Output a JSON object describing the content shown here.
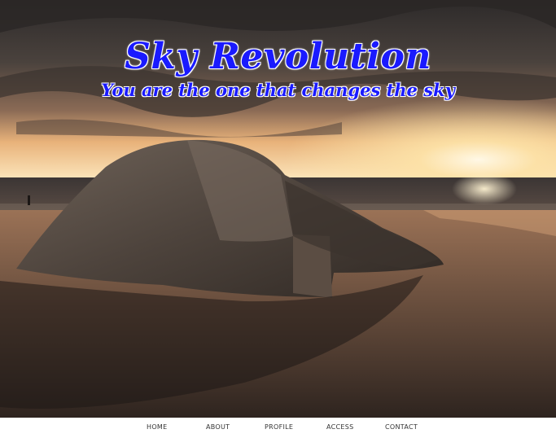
{
  "header": {
    "title": "Sky Revolution",
    "tagline": "You are the one that changes the sky"
  },
  "hero": {
    "image": "beach-bunker-sunset",
    "colors": {
      "sky_dark": "#3b3633",
      "sun_glow": "#f7c98a",
      "sea": "#2f2a29",
      "sand": "#7a5a44",
      "title_blue": "#1a1aff"
    }
  },
  "nav": {
    "items": [
      {
        "label": "HOME"
      },
      {
        "label": "ABOUT"
      },
      {
        "label": "PROFILE"
      },
      {
        "label": "ACCESS"
      },
      {
        "label": "CONTACT"
      }
    ]
  }
}
